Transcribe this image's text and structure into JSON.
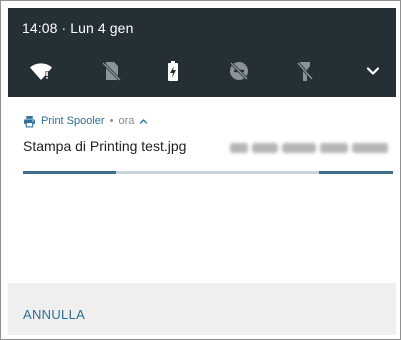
{
  "status_bar": {
    "time_date": "14:08 · Lun 4 gen"
  },
  "quick_settings": [
    {
      "id": "wifi",
      "icon": "wifi-alert-icon"
    },
    {
      "id": "mobile",
      "icon": "no-sim-icon"
    },
    {
      "id": "battery",
      "icon": "battery-charging-icon"
    },
    {
      "id": "dnd",
      "icon": "dnd-off-icon"
    },
    {
      "id": "flashlight",
      "icon": "flashlight-off-icon"
    },
    {
      "id": "expand",
      "icon": "chevron-down-icon"
    }
  ],
  "notification": {
    "app_name": "Print Spooler",
    "separator": "•",
    "time": "ora",
    "title": "Stampa di Printing test.jpg",
    "progress_segments": [
      {
        "start": 0.0,
        "end": 0.25
      },
      {
        "start": 0.8,
        "end": 1.0
      }
    ]
  },
  "actions": {
    "cancel_label": "ANNULLA"
  },
  "colors": {
    "shade_bg": "#253036",
    "accent": "#2e6f96",
    "progress": "#3f6f8d",
    "progress_track": "#c6d4dc",
    "action_bar_bg": "#efefef"
  }
}
